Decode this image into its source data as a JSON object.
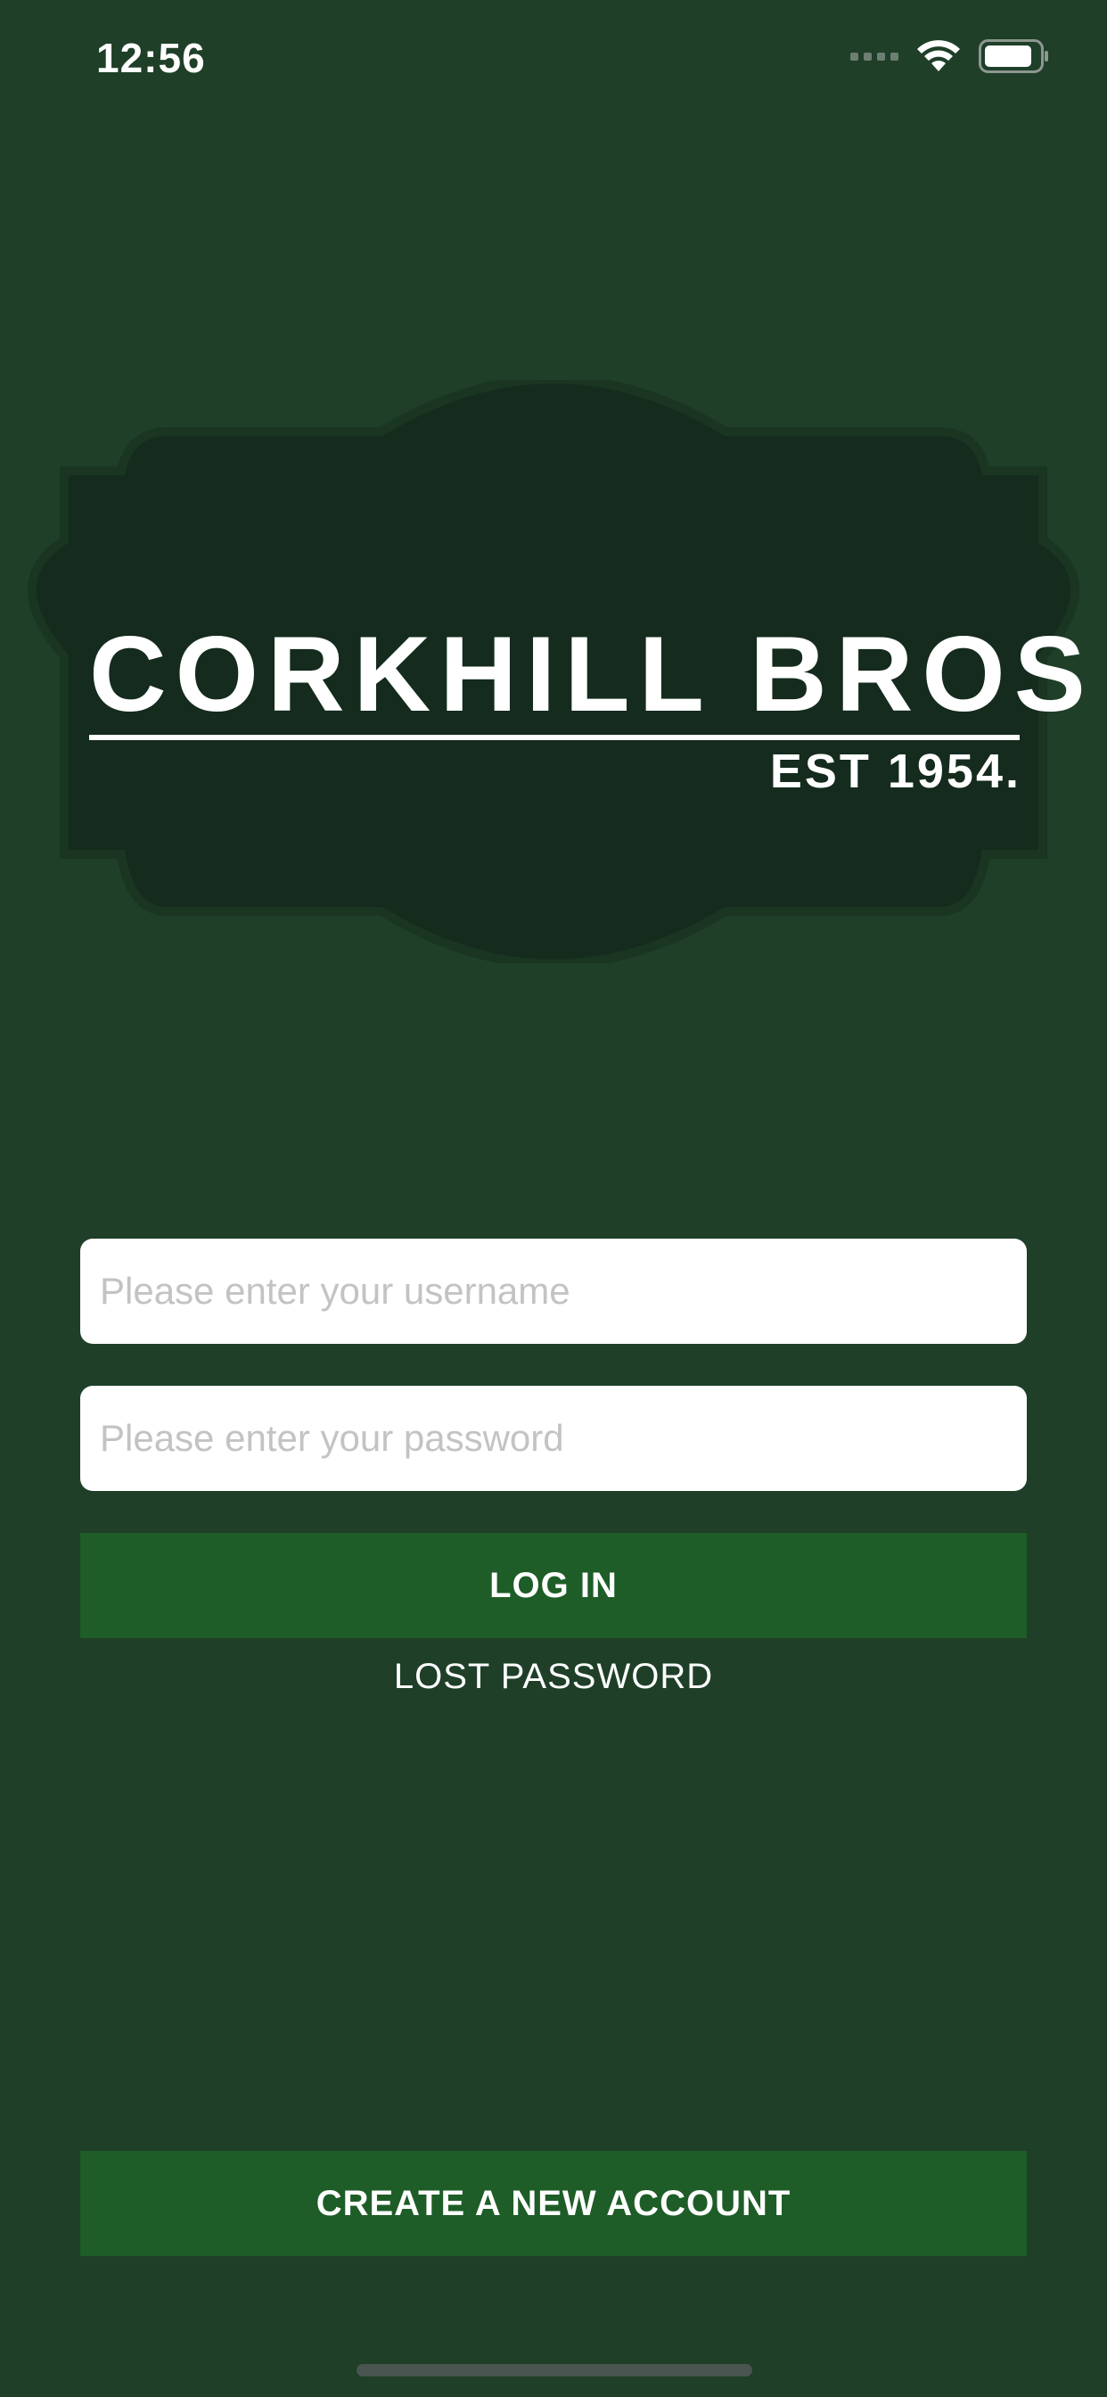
{
  "status_bar": {
    "time": "12:56",
    "icons": [
      "cellular-signal-icon",
      "wifi-icon",
      "battery-icon"
    ]
  },
  "logo": {
    "name": "CORKHILL BROS",
    "established": "EST 1954."
  },
  "login_form": {
    "username_placeholder": "Please enter your username",
    "password_placeholder": "Please enter your password",
    "login_label": "LOG IN",
    "lost_password_label": "LOST PASSWORD"
  },
  "footer": {
    "create_account_label": "CREATE A NEW ACCOUNT"
  },
  "colors": {
    "background": "#1f3f28",
    "logo_badge": "#142b1d",
    "logo_badge_border": "#1a3522",
    "button": "#1e5d27",
    "input_background": "#ffffff",
    "placeholder": "#c3c3c6"
  }
}
